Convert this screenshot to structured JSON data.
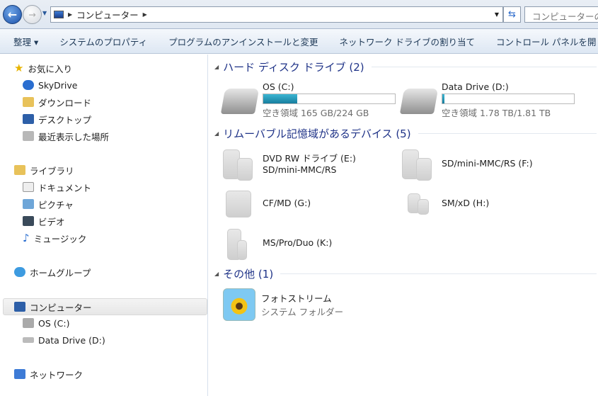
{
  "address": {
    "path": [
      "コンピューター"
    ],
    "search_placeholder": "コンピューターの検索"
  },
  "toolbar": {
    "organize": "整理 ▾",
    "items": [
      "システムのプロパティ",
      "プログラムのアンインストールと変更",
      "ネットワーク ドライブの割り当て",
      "コントロール パネルを開く"
    ]
  },
  "sidebar": {
    "favorites": {
      "label": "お気に入り",
      "items": [
        "SkyDrive",
        "ダウンロード",
        "デスクトップ",
        "最近表示した場所"
      ]
    },
    "libraries": {
      "label": "ライブラリ",
      "items": [
        "ドキュメント",
        "ピクチャ",
        "ビデオ",
        "ミュージック"
      ]
    },
    "homegroup": "ホームグループ",
    "computer": {
      "label": "コンピューター",
      "items": [
        "OS (C:)",
        "Data Drive (D:)"
      ]
    },
    "network": "ネットワーク"
  },
  "groups": {
    "hdd": {
      "title": "ハード ディスク ドライブ (2)",
      "drives": [
        {
          "name": "OS (C:)",
          "free": "空き領域 165 GB/224 GB",
          "used_fraction": 0.26
        },
        {
          "name": "Data Drive (D:)",
          "free": "空き領域 1.78 TB/1.81 TB",
          "used_fraction": 0.017
        }
      ]
    },
    "removable": {
      "title": "リムーバブル記憶域があるデバイス (5)",
      "items": [
        {
          "name": "DVD RW ドライブ (E:)",
          "sub": "SD/mini-MMC/RS"
        },
        {
          "name": "SD/mini-MMC/RS (F:)"
        },
        {
          "name": "CF/MD (G:)"
        },
        {
          "name": "SM/xD (H:)"
        },
        {
          "name": "MS/Pro/Duo (K:)"
        }
      ]
    },
    "other": {
      "title": "その他 (1)",
      "items": [
        {
          "name": "フォトストリーム",
          "sub": "システム フォルダー"
        }
      ]
    }
  }
}
